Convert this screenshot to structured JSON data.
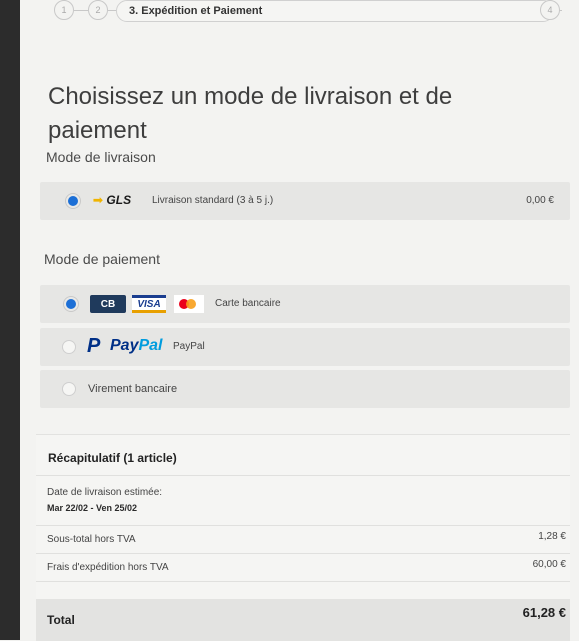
{
  "stepper": {
    "steps": [
      {
        "number": "1"
      },
      {
        "number": "2"
      },
      {
        "label": "3. Expédition et Paiement"
      },
      {
        "number": "4"
      }
    ]
  },
  "title": "Choisissez un mode de livraison et de paiement",
  "delivery": {
    "section_title": "Mode de livraison",
    "options": [
      {
        "logo": "GLS",
        "label": "Livraison standard (3 à 5 j.)",
        "price": "0,00 €",
        "selected": true
      }
    ]
  },
  "payment": {
    "section_title": "Mode de paiement",
    "options": [
      {
        "logos": [
          "CB",
          "VISA",
          "mastercard-icon"
        ],
        "label": "Carte bancaire",
        "selected": true
      },
      {
        "logo_p": "P",
        "logo_pay": "Pay",
        "logo_pal": "Pal",
        "label": "PayPal",
        "selected": false
      },
      {
        "label": "Virement bancaire",
        "selected": false
      }
    ]
  },
  "summary": {
    "title": "Récapitulatif (1 article)",
    "delivery_date_label": "Date de livraison estimée:",
    "delivery_date_value": "Mar 22/02 - Ven 25/02",
    "subtotal_label": "Sous-total hors TVA",
    "subtotal_value": "1,28 €",
    "shipping_label": "Frais d'expédition hors TVA",
    "shipping_value": "60,00 €",
    "total_label": "Total",
    "total_value": "61,28 €"
  },
  "colors": {
    "radio_selected": "#1c6fd6",
    "paypal_dark": "#003087",
    "paypal_light": "#009cde",
    "gls_yellow": "#f0b400",
    "mastercard_red": "#eb001b",
    "mastercard_orange": "#f79e1b"
  }
}
